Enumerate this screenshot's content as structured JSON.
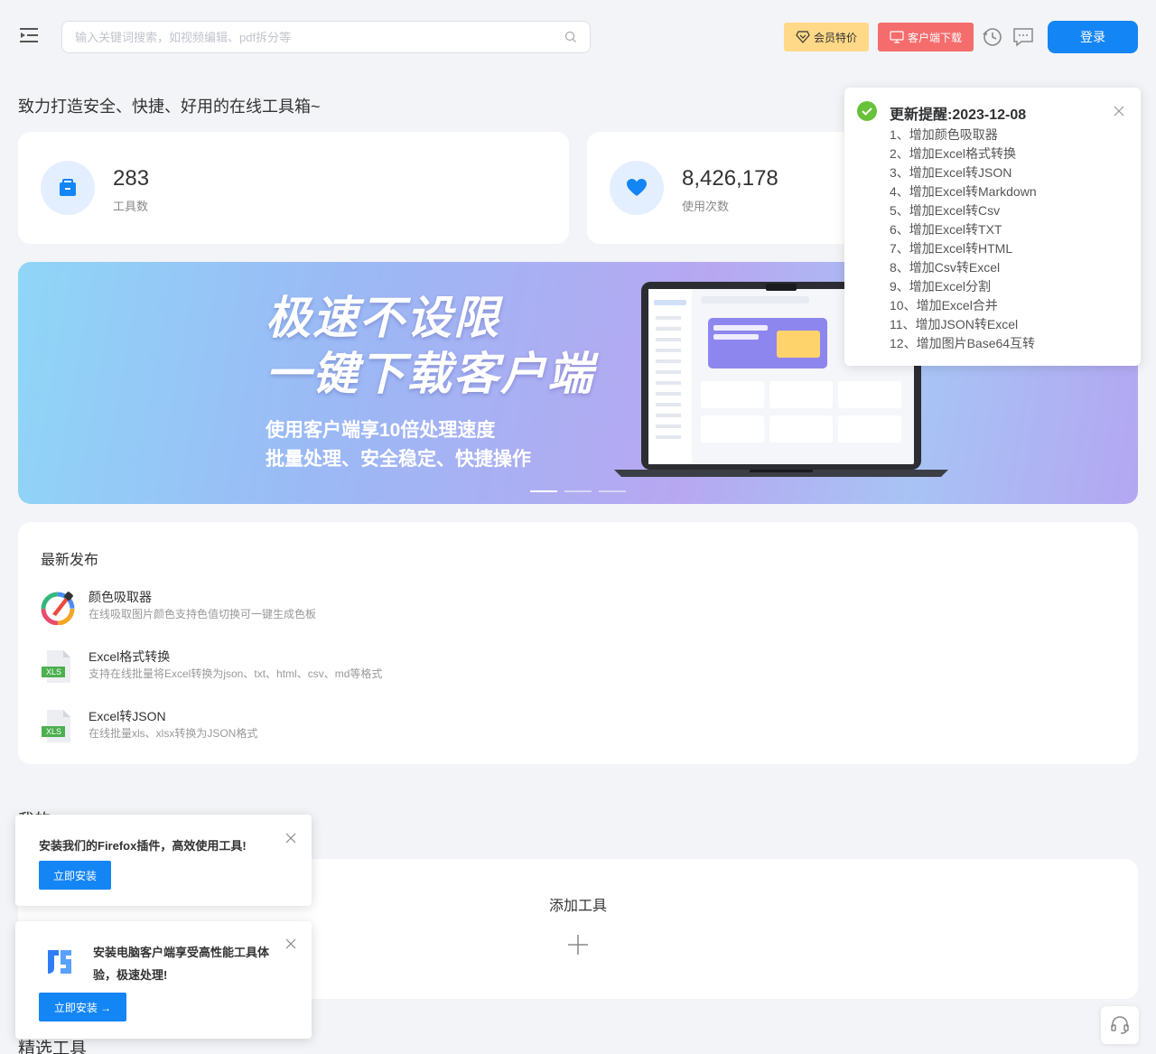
{
  "header": {
    "search_placeholder": "输入关键词搜索，如视频编辑、pdf拆分等",
    "vip_label": "会员特价",
    "client_label": "客户端下载",
    "login_label": "登录"
  },
  "slogan": "致力打造安全、快捷、好用的在线工具箱~",
  "stats": [
    {
      "value": "283",
      "label": "工具数"
    },
    {
      "value": "8,426,178",
      "label": "使用次数"
    }
  ],
  "banner": {
    "title_line1": "极速不设限",
    "title_line2": "一键下载客户端",
    "sub_line1": "使用客户端享10倍处理速度",
    "sub_line2": "批量处理、安全稳定、快捷操作",
    "slides": 3,
    "active_slide": 1
  },
  "latest": {
    "title": "最新发布",
    "items": [
      {
        "name": "颜色吸取器",
        "desc": "在线吸取图片颜色支持色值切换可一键生成色板",
        "icon": "color-picker-icon"
      },
      {
        "name": "Excel格式转换",
        "desc": "支持在线批量将Excel转换为json、txt、html、csv、md等格式",
        "icon": "xls-file-icon",
        "badge": "XLS"
      },
      {
        "name": "Excel转JSON",
        "desc": "在线批量xls、xlsx转换为JSON格式",
        "icon": "xls-file-icon",
        "badge": "XLS"
      }
    ]
  },
  "favorites": {
    "label": "我的",
    "add_label": "添加工具"
  },
  "picked_title": "精选工具",
  "notice": {
    "title": "更新提醒:2023-12-08",
    "items": [
      "1、增加颜色吸取器",
      "2、增加Excel格式转换",
      "3、增加Excel转JSON",
      "4、增加Excel转Markdown",
      "5、增加Excel转Csv",
      "6、增加Excel转TXT",
      "7、增加Excel转HTML",
      "8、增加Csv转Excel",
      "9、增加Excel分割",
      "10、增加Excel合并",
      "11、增加JSON转Excel",
      "12、增加图片Base64互转"
    ]
  },
  "popups": {
    "firefox_msg": "安装我们的Firefox插件，高效使用工具!",
    "firefox_btn": "立即安装",
    "client_msg": "安装电脑客户端享受高性能工具体验，极速处理!",
    "client_btn": "立即安装 →"
  },
  "colors": {
    "primary": "#1485f4",
    "vip": "#ffd987",
    "client": "#f56c6c",
    "success": "#67c23a"
  }
}
